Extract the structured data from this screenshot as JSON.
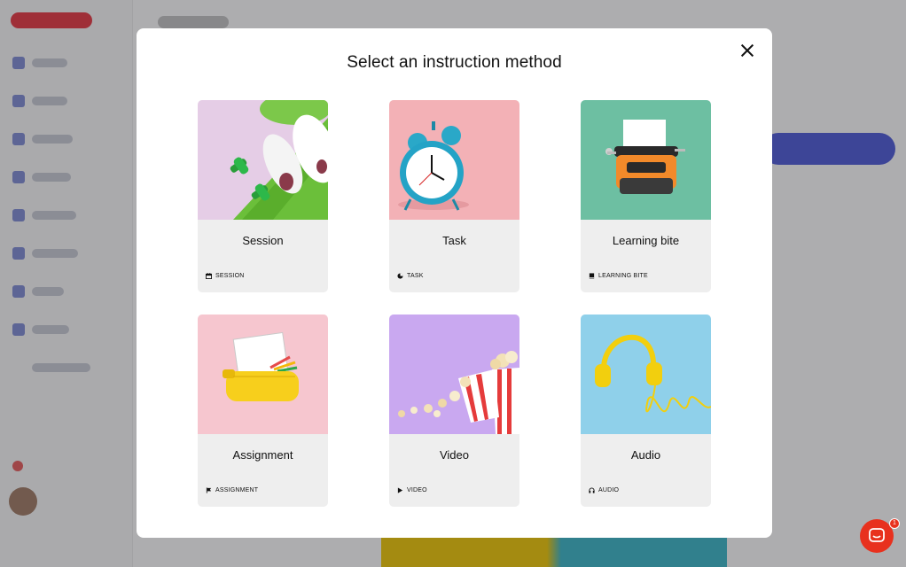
{
  "modal": {
    "title": "Select an instruction method",
    "close_icon": "close-icon"
  },
  "cards": [
    {
      "title": "Session",
      "tag": "SESSION",
      "tag_icon": "calendar-icon",
      "image": "sneakers-and-dumbbells-on-yoga-mat"
    },
    {
      "title": "Task",
      "tag": "TASK",
      "tag_icon": "pie-icon",
      "image": "blue-alarm-clock"
    },
    {
      "title": "Learning bite",
      "tag": "LEARNING BITE",
      "tag_icon": "book-icon",
      "image": "orange-typewriter"
    },
    {
      "title": "Assignment",
      "tag": "ASSIGNMENT",
      "tag_icon": "flag-icon",
      "image": "notebook-and-pencil-case"
    },
    {
      "title": "Video",
      "tag": "VIDEO",
      "tag_icon": "play-icon",
      "image": "popcorn-buckets"
    },
    {
      "title": "Audio",
      "tag": "AUDIO",
      "tag_icon": "headphones-icon",
      "image": "yellow-headphones"
    }
  ],
  "chat": {
    "icon": "chat-icon",
    "badge_count": "1"
  },
  "colors": {
    "accent": "#4b57d9",
    "brand": "#e8343f",
    "chat": "#e8311e"
  }
}
